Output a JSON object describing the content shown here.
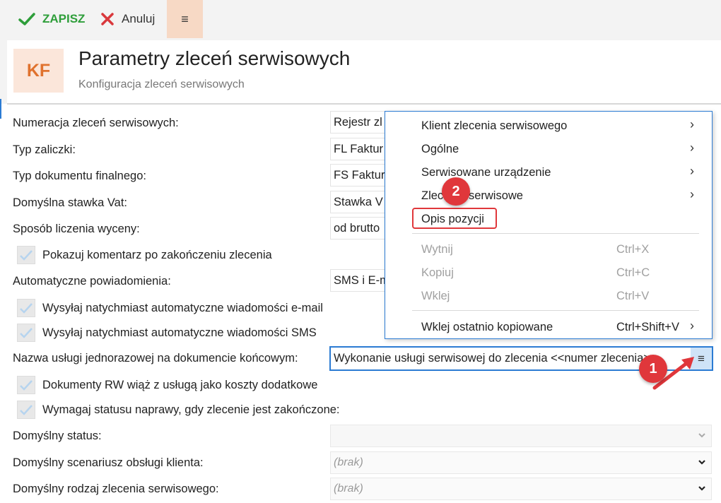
{
  "toolbar": {
    "save_label": "ZAPISZ",
    "cancel_label": "Anuluj",
    "menu_label": "≡"
  },
  "header": {
    "badge": "KF",
    "title": "Parametry zleceń serwisowych",
    "subtitle": "Konfiguracja zleceń serwisowych"
  },
  "form": {
    "numeracja_label": "Numeracja zleceń serwisowych:",
    "numeracja_value": "Rejestr zl",
    "typ_zaliczki_label": "Typ zaliczki:",
    "typ_zaliczki_value": "FL  Faktur",
    "typ_dok_label": "Typ dokumentu finalnego:",
    "typ_dok_value": "FS  Faktur",
    "stawka_label": "Domyślna stawka Vat:",
    "stawka_value": "Stawka V",
    "sposob_label": "Sposób liczenia wyceny:",
    "sposob_value": "od brutto",
    "chk_komentarz": "Pokazuj komentarz po zakończeniu zlecenia",
    "powiadomienia_label": "Automatyczne powiadomienia:",
    "powiadomienia_value": "SMS i E-m",
    "chk_email": "Wysyłaj natychmiast automatyczne wiadomości e-mail",
    "chk_sms": "Wysyłaj natychmiast automatyczne wiadomości SMS",
    "nazwa_label": "Nazwa usługi jednorazowej na dokumencie końcowym:",
    "nazwa_value": "Wykonanie usługi serwisowej do zlecenia <<numer zlecenia>>",
    "nazwa_menu": "≡",
    "chk_rw": "Dokumenty RW wiąż z usługą jako koszty dodatkowe",
    "chk_status": "Wymagaj statusu naprawy, gdy zlecenie jest zakończone:",
    "status_label": "Domyślny status:",
    "scenariusz_label": "Domyślny scenariusz obsługi klienta:",
    "scenariusz_value": "(brak)",
    "rodzaj_label": "Domyślny rodzaj zlecenia serwisowego:",
    "rodzaj_value": "(brak)"
  },
  "context_menu": {
    "klient": "Klient zlecenia serwisowego",
    "ogolne": "Ogólne",
    "urzadzenie": "Serwisowane urządzenie",
    "zlecenie": "Zlecenie serwisowe",
    "opis": "Opis pozycji",
    "wytnij": "Wytnij",
    "wytnij_sc": "Ctrl+X",
    "kopiuj": "Kopiuj",
    "kopiuj_sc": "Ctrl+C",
    "wklej": "Wklej",
    "wklej_sc": "Ctrl+V",
    "wklej_ost": "Wklej ostatnio kopiowane",
    "wklej_ost_sc": "Ctrl+Shift+V",
    "arrow": "›"
  },
  "annotations": {
    "step1": "1",
    "step2": "2"
  },
  "colors": {
    "accent_blue": "#2b7bd3",
    "save_green": "#2e9e3a",
    "cancel_red": "#d9383c",
    "badge_orange": "#e0722e",
    "annotation_red": "#e0373b"
  }
}
